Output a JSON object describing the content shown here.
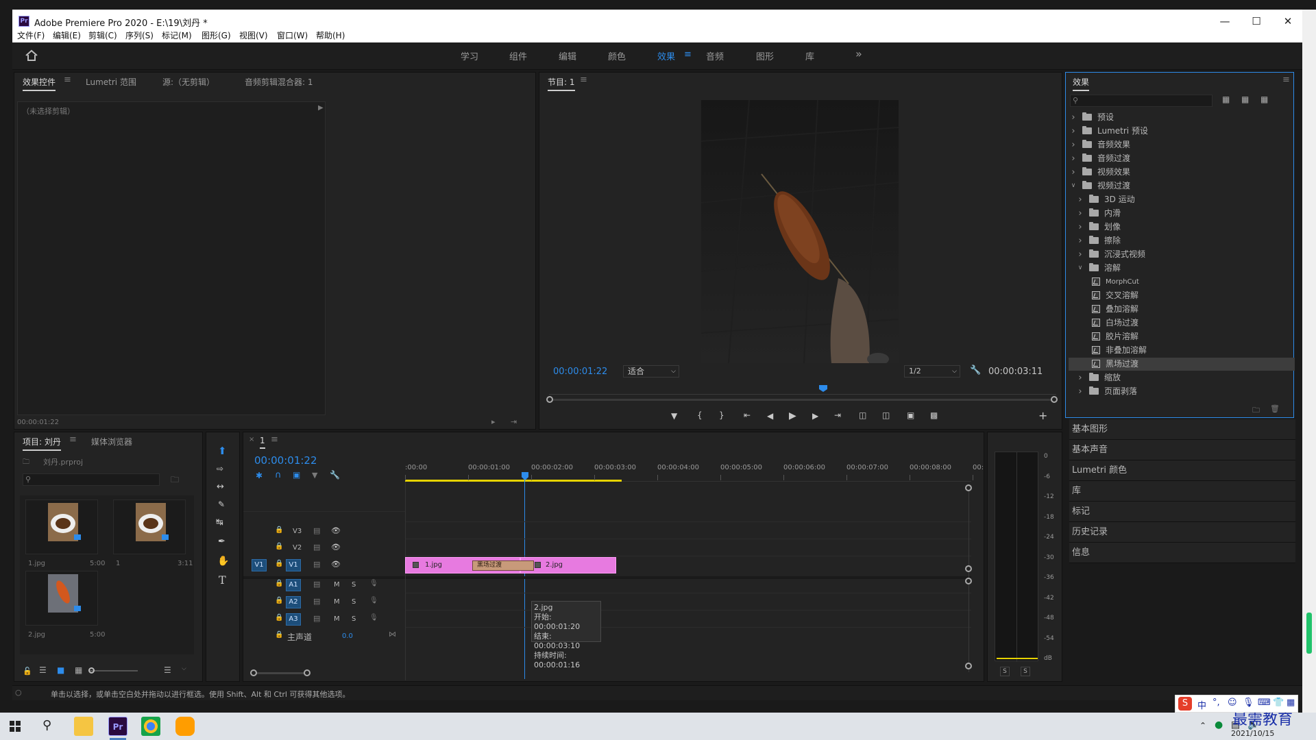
{
  "window": {
    "title": "Adobe Premiere Pro 2020 - E:\\19\\刘丹 *",
    "app_badge": "Pr"
  },
  "menu": [
    "文件(F)",
    "编辑(E)",
    "剪辑(C)",
    "序列(S)",
    "标记(M)",
    "图形(G)",
    "视图(V)",
    "窗口(W)",
    "帮助(H)"
  ],
  "workspaces": [
    "学习",
    "组件",
    "编辑",
    "颜色",
    "效果",
    "音频",
    "图形",
    "库"
  ],
  "workspace_active": "效果",
  "source_panel": {
    "tabs": [
      "效果控件",
      "Lumetri 范围",
      "源:（无剪辑）",
      "音频剪辑混合器: 1"
    ],
    "no_clip": "（未选择剪辑）",
    "timecode": "00:00:01:22"
  },
  "program": {
    "tab": "节目: 1",
    "timecode": "00:00:01:22",
    "fit": "适合",
    "resolution": "1/2",
    "duration": "00:00:03:11"
  },
  "effects_panel": {
    "title": "效果",
    "items": [
      {
        "label": "预设",
        "level": 0,
        "expanded": false,
        "kind": "folder"
      },
      {
        "label": "Lumetri 预设",
        "level": 0,
        "expanded": false,
        "kind": "folder"
      },
      {
        "label": "音频效果",
        "level": 0,
        "expanded": false,
        "kind": "folder"
      },
      {
        "label": "音频过渡",
        "level": 0,
        "expanded": false,
        "kind": "folder"
      },
      {
        "label": "视频效果",
        "level": 0,
        "expanded": false,
        "kind": "folder"
      },
      {
        "label": "视频过渡",
        "level": 0,
        "expanded": true,
        "kind": "folder"
      },
      {
        "label": "3D 运动",
        "level": 1,
        "expanded": false,
        "kind": "folder"
      },
      {
        "label": "内滑",
        "level": 1,
        "expanded": false,
        "kind": "folder"
      },
      {
        "label": "划像",
        "level": 1,
        "expanded": false,
        "kind": "folder"
      },
      {
        "label": "擦除",
        "level": 1,
        "expanded": false,
        "kind": "folder"
      },
      {
        "label": "沉浸式视频",
        "level": 1,
        "expanded": false,
        "kind": "folder"
      },
      {
        "label": "溶解",
        "level": 1,
        "expanded": true,
        "kind": "folder"
      },
      {
        "label": "MorphCut",
        "level": 2,
        "kind": "fx"
      },
      {
        "label": "交叉溶解",
        "level": 2,
        "kind": "fx"
      },
      {
        "label": "叠加溶解",
        "level": 2,
        "kind": "fx"
      },
      {
        "label": "白场过渡",
        "level": 2,
        "kind": "fx"
      },
      {
        "label": "胶片溶解",
        "level": 2,
        "kind": "fx"
      },
      {
        "label": "非叠加溶解",
        "level": 2,
        "kind": "fx"
      },
      {
        "label": "黑场过渡",
        "level": 2,
        "kind": "fx",
        "selected": true
      },
      {
        "label": "缩放",
        "level": 1,
        "expanded": false,
        "kind": "folder"
      },
      {
        "label": "页面剥落",
        "level": 1,
        "expanded": false,
        "kind": "folder"
      }
    ]
  },
  "side_panels": [
    "基本图形",
    "基本声音",
    "Lumetri 颜色",
    "库",
    "标记",
    "历史记录",
    "信息"
  ],
  "project": {
    "tabs": [
      "项目: 刘丹",
      "媒体浏览器"
    ],
    "file": "刘丹.prproj",
    "items": [
      {
        "name": "1.jpg",
        "duration": "5:00"
      },
      {
        "name": "1",
        "duration": "3:11"
      },
      {
        "name": "2.jpg",
        "duration": "5:00"
      }
    ]
  },
  "timeline": {
    "tab": "1",
    "timecode": "00:00:01:22",
    "ruler": [
      ":00:00",
      "00:00:01:00",
      "00:00:02:00",
      "00:00:03:00",
      "00:00:04:00",
      "00:00:05:00",
      "00:00:06:00",
      "00:00:07:00",
      "00:00:08:00",
      "00:0"
    ],
    "video_tracks": [
      "V3",
      "V2",
      "V1"
    ],
    "audio_tracks": [
      "A1",
      "A2",
      "A3"
    ],
    "mute": "M",
    "solo": "S",
    "master": "主声道",
    "master_value": "0.0",
    "clips": [
      "1.jpg",
      "黑场过渡",
      "2.jpg"
    ],
    "tooltip": {
      "name": "2.jpg",
      "start": "开始: 00:00:01:20",
      "end": "结束: 00:00:03:10",
      "duration": "持续时间: 00:00:01:16"
    }
  },
  "meter": {
    "scale": [
      "0",
      "-6",
      "-12",
      "-18",
      "-24",
      "-30",
      "-36",
      "-42",
      "-48",
      "-54",
      "dB"
    ],
    "solo": [
      "S",
      "S"
    ]
  },
  "status_bar": "单击以选择，或单击空白处并拖动以进行框选。使用 Shift、Alt 和 Ctrl 可获得其他选项。",
  "taskbar": {
    "date": "2021/10/15",
    "watermark": "最需教育",
    "ime": "中"
  },
  "colors": {
    "accent": "#2d8ceb",
    "clip": "#e77ae0",
    "yellow_bar": "#e6d200"
  }
}
